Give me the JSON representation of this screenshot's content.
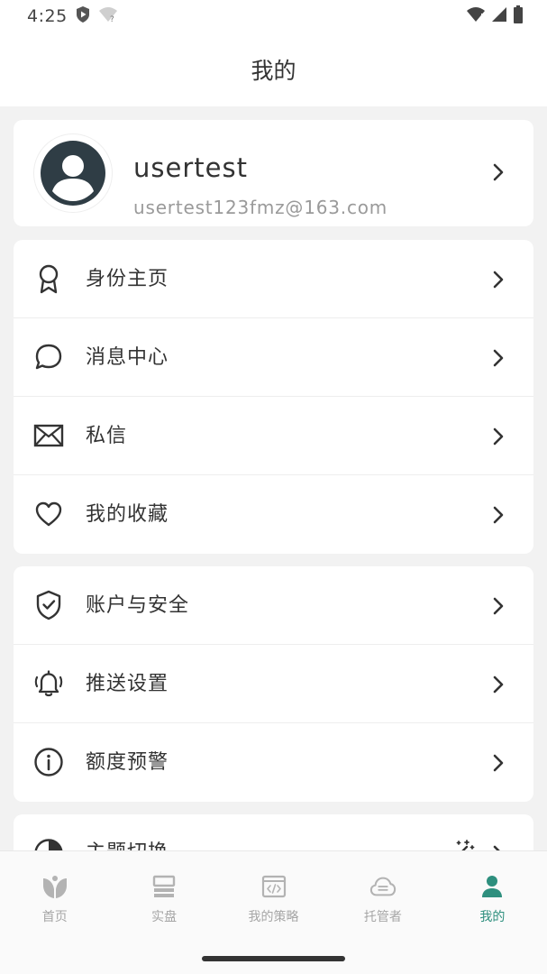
{
  "status_bar": {
    "time": "4:25"
  },
  "header": {
    "title": "我的"
  },
  "profile": {
    "name": "usertest",
    "email": "usertest123fmz@163.com"
  },
  "menu_group_1": [
    {
      "label": "身份主页",
      "icon": "badge-icon"
    },
    {
      "label": "消息中心",
      "icon": "chat-bubble-icon"
    },
    {
      "label": "私信",
      "icon": "mail-icon"
    },
    {
      "label": "我的收藏",
      "icon": "heart-icon"
    }
  ],
  "menu_group_2": [
    {
      "label": "账户与安全",
      "icon": "shield-check-icon"
    },
    {
      "label": "推送设置",
      "icon": "bell-icon"
    },
    {
      "label": "额度预警",
      "icon": "info-icon"
    }
  ],
  "menu_group_3": [
    {
      "label": "主题切换",
      "icon": "theme-icon"
    }
  ],
  "bottom_nav": {
    "tabs": [
      {
        "label": "首页",
        "icon": "home-logo-icon",
        "active": false
      },
      {
        "label": "实盘",
        "icon": "server-icon",
        "active": false
      },
      {
        "label": "我的策略",
        "icon": "code-window-icon",
        "active": false
      },
      {
        "label": "托管者",
        "icon": "cloud-icon",
        "active": false
      },
      {
        "label": "我的",
        "icon": "person-icon",
        "active": true
      }
    ]
  },
  "colors": {
    "accent": "#2e8f7e",
    "icon_dark": "#333333",
    "inactive": "#a6a6a6"
  }
}
